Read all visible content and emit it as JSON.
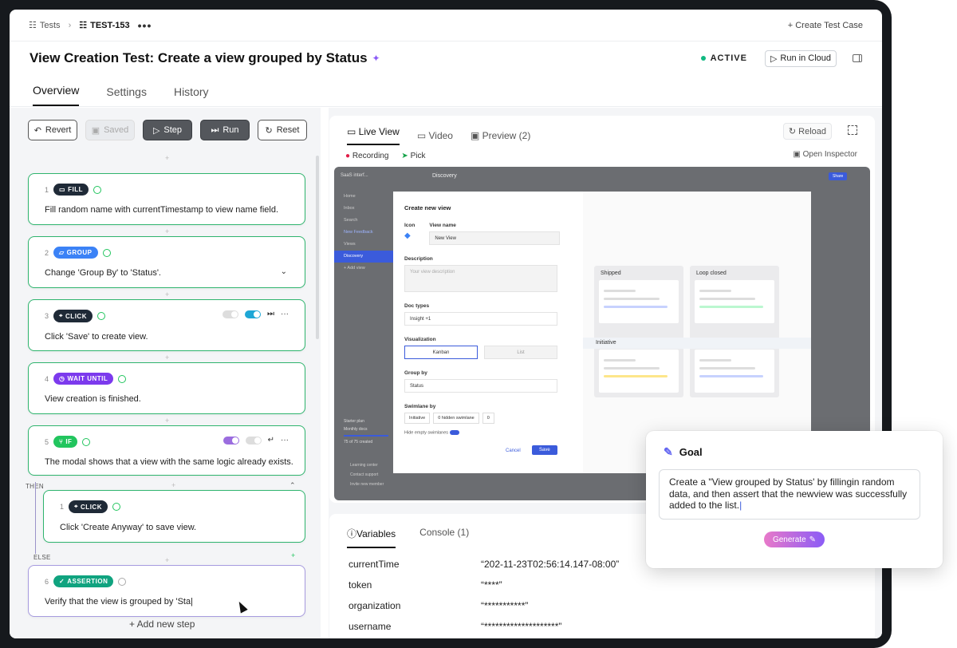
{
  "breadcrumb": {
    "tests": "Tests",
    "current": "TEST-153",
    "more": "•••"
  },
  "header": {
    "create_case": "+ Create Test Case",
    "title": "View Creation Test: Create a view grouped by Status",
    "status": "ACTIVE",
    "run_cloud": "Run in Cloud"
  },
  "tabs": [
    "Overview",
    "Settings",
    "History"
  ],
  "toolbar": {
    "revert": "Revert",
    "saved": "Saved",
    "step": "Step",
    "run": "Run",
    "reset": "Reset"
  },
  "steps": [
    {
      "num": "1",
      "badge": "FILL",
      "text": "Fill random name with currentTimestamp to view name field."
    },
    {
      "num": "2",
      "badge": "GROUP",
      "text": "Change 'Group By' to 'Status'."
    },
    {
      "num": "3",
      "badge": "CLICK",
      "text": "Click 'Save' to create view."
    },
    {
      "num": "4",
      "badge": "WAIT UNTIL",
      "text": "View creation is finished."
    },
    {
      "num": "5",
      "badge": "IF",
      "text": "The modal shows that a view with the same logic already exists."
    },
    {
      "num": "1",
      "badge": "CLICK",
      "text": "Click 'Create Anyway' to save view."
    },
    {
      "num": "6",
      "badge": "ASSERTION",
      "text": "Verify that the view is grouped by 'Sta"
    }
  ],
  "branch": {
    "then": "THEN",
    "else": "ELSE"
  },
  "add_step": "+ Add new step",
  "viewer": {
    "tabs": [
      "Live View",
      "Video",
      "Preview (2)"
    ],
    "reload": "Reload",
    "recording": "Recording",
    "pick": "Pick",
    "inspector": "Open Inspector"
  },
  "modal": {
    "title": "Create new view",
    "icon_label": "Icon",
    "view_name_label": "View name",
    "view_name": "New View",
    "desc_label": "Description",
    "desc_placeholder": "Your view description",
    "doc_types_label": "Doc types",
    "doc_type": "Insight +1",
    "viz_label": "Visualization",
    "viz_kanban": "Kanban",
    "viz_list": "List",
    "group_label": "Group by",
    "group": "Status",
    "swim_label": "Swimlane by",
    "swim": "Initiative",
    "hidden": "0 hidden swimlane",
    "filter": "0",
    "hide_empty": "Hide empty swimlanes",
    "cancel": "Cancel",
    "save": "Save",
    "col1": "Shipped",
    "col2": "Loop closed",
    "initiative": "Initiative"
  },
  "app_sidebar": {
    "workspace": "SaaS interf...",
    "items": [
      "Home",
      "Inbox",
      "Search",
      "New Feedback",
      "Views",
      "Discovery",
      "+ Add view"
    ],
    "page": "Discovery",
    "share": "Share",
    "plan": "Starter plan",
    "monthly": "Monthly docs",
    "used": "75 of 75 created",
    "footer": [
      "Learning center",
      "Contact support",
      "Invite new member"
    ]
  },
  "console": {
    "tabs": [
      "Variables",
      "Console (1)"
    ],
    "vars": [
      {
        "k": "currentTime",
        "v": "“202-11-23T02:56:14.147-08:00”"
      },
      {
        "k": "token",
        "v": "“****”"
      },
      {
        "k": "organization",
        "v": "“***********”"
      },
      {
        "k": "username",
        "v": "“********************”"
      }
    ]
  },
  "goal": {
    "title": "Goal",
    "text": "Create a \"View grouped by Status' by fillingin random data, and then assert that the newview was successfully added to the list.",
    "generate": "Generate"
  }
}
